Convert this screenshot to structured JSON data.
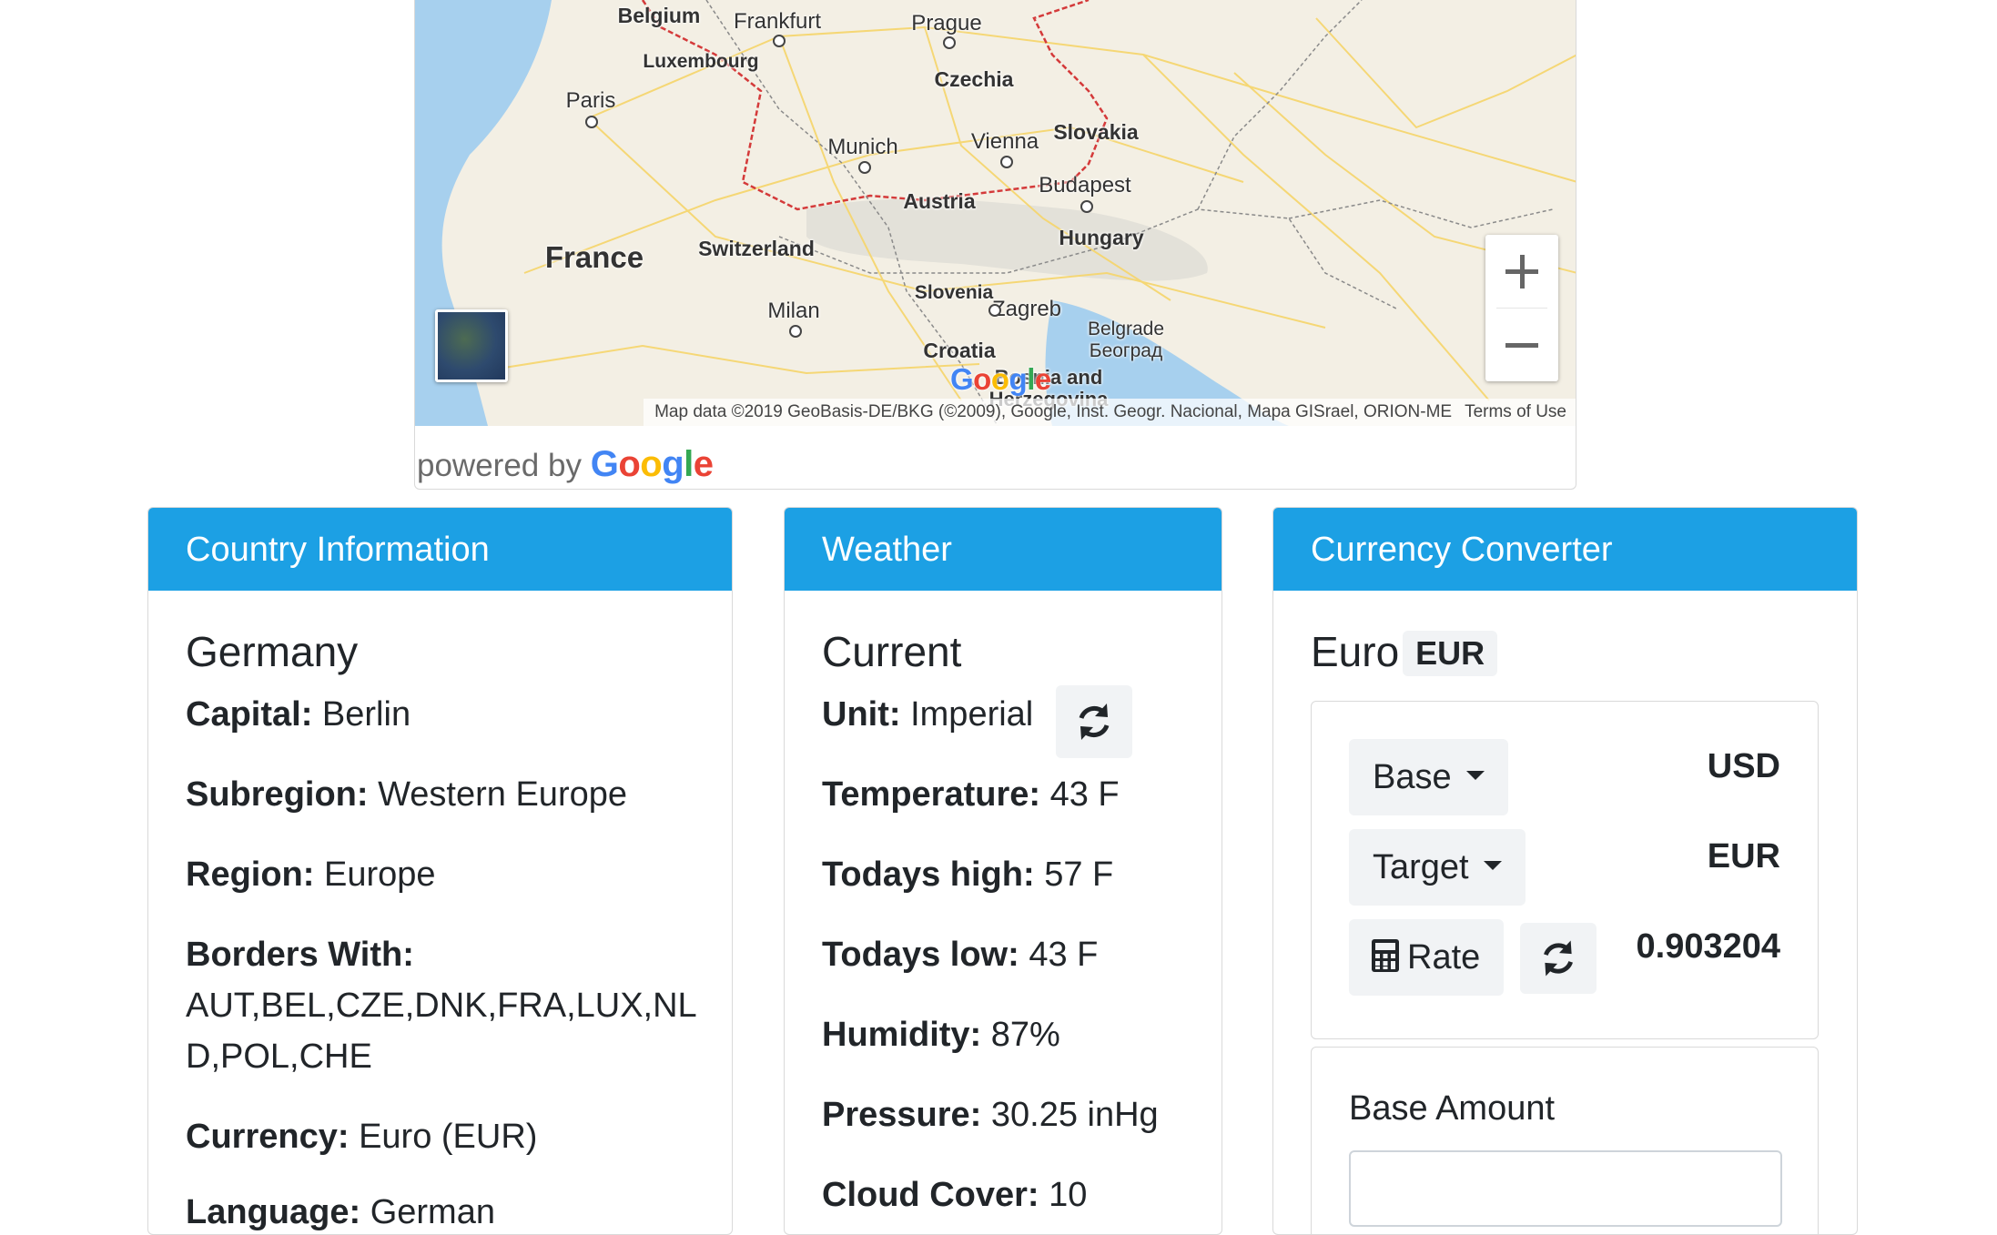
{
  "map": {
    "cities": [
      {
        "name": "Belgium",
        "country": true
      },
      {
        "name": "Frankfurt"
      },
      {
        "name": "Prague"
      },
      {
        "name": "Luxembourg",
        "country": true
      },
      {
        "name": "Czechia",
        "country": true
      },
      {
        "name": "Paris"
      },
      {
        "name": "Vienna"
      },
      {
        "name": "Slovakia",
        "country": true
      },
      {
        "name": "Munich"
      },
      {
        "name": "Budapest"
      },
      {
        "name": "Austria",
        "country": true
      },
      {
        "name": "France",
        "country": true
      },
      {
        "name": "Switzerland",
        "country": true
      },
      {
        "name": "Hungary",
        "country": true
      },
      {
        "name": "Slovenia",
        "country": true
      },
      {
        "name": "Zagreb"
      },
      {
        "name": "Milan"
      },
      {
        "name": "Croatia",
        "country": true
      },
      {
        "name": "Belgrade"
      },
      {
        "name": "Београд"
      },
      {
        "name": "Bosnia and",
        "country": true
      },
      {
        "name": "Herzegovina",
        "country": true
      }
    ],
    "attribution": "Map data ©2019 GeoBasis-DE/BKG (©2009), Google, Inst. Geogr. Nacional, Mapa GISrael, ORION-ME",
    "terms": "Terms of Use",
    "powered_by": "powered by",
    "google_letters": [
      "G",
      "o",
      "o",
      "g",
      "l",
      "e"
    ],
    "zoom_in_icon": "plus-icon",
    "zoom_out_icon": "minus-icon",
    "colors": {
      "land": "#f3efe4",
      "water": "#a7d0ee",
      "border": "#d43a3a",
      "road": "#f6d56a",
      "google_blue": "#4285F4",
      "google_red": "#EA4335",
      "google_yellow": "#FBBC05",
      "google_green": "#34A853"
    }
  },
  "country_card": {
    "header": "Country Information",
    "name": "Germany",
    "capital_label": "Capital:",
    "capital": "Berlin",
    "subregion_label": "Subregion:",
    "subregion": "Western Europe",
    "region_label": "Region:",
    "region": "Europe",
    "borders_label": "Borders With:",
    "borders_line1": "AUT,BEL,CZE,DNK,FRA,LUX,NL",
    "borders_line2": "D,POL,CHE",
    "currency_label": "Currency:",
    "currency": "Euro (EUR)",
    "language_label": "Language:",
    "language": "German"
  },
  "weather_card": {
    "header": "Weather",
    "title": "Current",
    "unit_label": "Unit:",
    "unit": "Imperial",
    "refresh_icon": "refresh-icon",
    "temperature_label": "Temperature:",
    "temperature": "43 F",
    "high_label": "Todays high:",
    "high": "57 F",
    "low_label": "Todays low:",
    "low": "43 F",
    "humidity_label": "Humidity:",
    "humidity": "87%",
    "pressure_label": "Pressure:",
    "pressure": "30.25 inHg",
    "cloud_label": "Cloud Cover:",
    "cloud": "10"
  },
  "currency_card": {
    "header": "Currency Converter",
    "currency_name": "Euro",
    "currency_code": "EUR",
    "base_button": "Base",
    "base_value": "USD",
    "target_button": "Target",
    "target_value": "EUR",
    "rate_button": "Rate",
    "rate_icon": "calculator-icon",
    "rate_value": "0.903204",
    "refresh_icon": "refresh-icon",
    "amount_label": "Base Amount",
    "amount_value": ""
  },
  "colors": {
    "accent": "#1ca0e4",
    "header_text": "#ffffff",
    "button_bg": "#f1f3f5"
  }
}
